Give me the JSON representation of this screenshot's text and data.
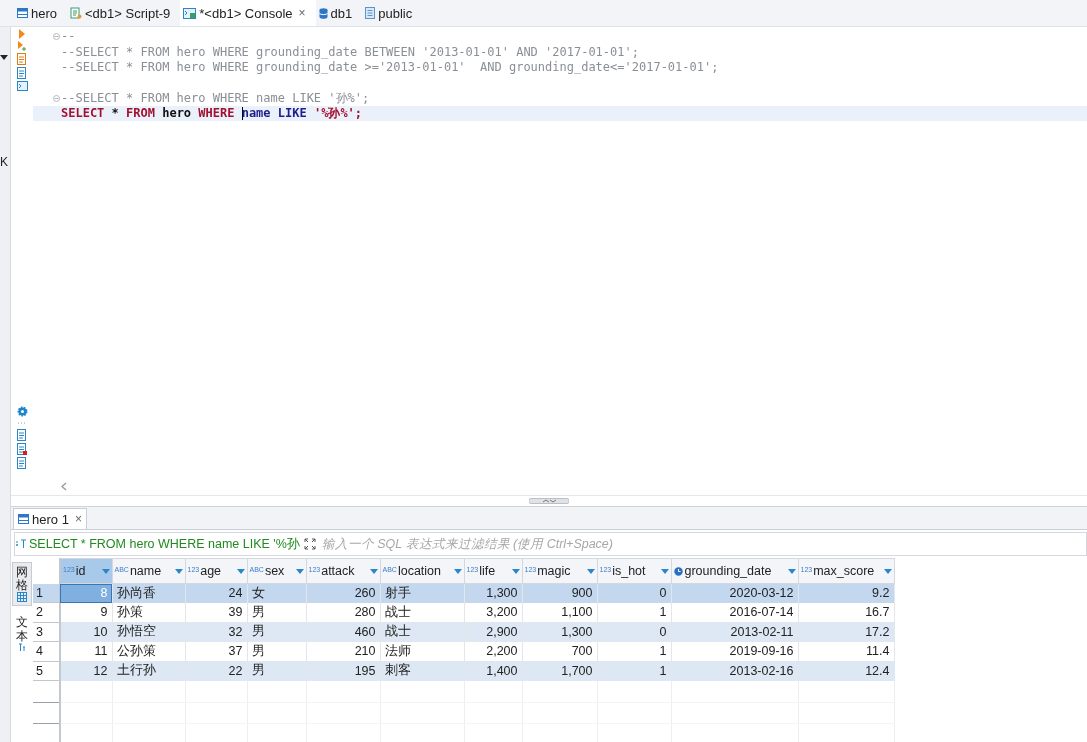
{
  "editor_tabs": [
    {
      "label": "hero",
      "kind": "table",
      "selected": false
    },
    {
      "label": "<db1> Script-9",
      "kind": "script",
      "selected": false
    },
    {
      "label": "*<db1> Console",
      "kind": "console",
      "selected": true,
      "close": "×"
    },
    {
      "label": "db1",
      "kind": "database",
      "selected": false
    },
    {
      "label": "public",
      "kind": "schema",
      "selected": false
    }
  ],
  "left_strip": {
    "label": "K"
  },
  "editor": {
    "lines": [
      {
        "kind": "code",
        "fold": true,
        "current": false,
        "tokens": [
          {
            "kind": "comment",
            "text": "--"
          }
        ]
      },
      {
        "kind": "code",
        "fold": false,
        "current": false,
        "tokens": [
          {
            "kind": "comment",
            "text": "--SELECT * FROM hero WHERE grounding_date BETWEEN '2013-01-01' AND '2017-01-01';"
          }
        ]
      },
      {
        "kind": "code",
        "fold": false,
        "current": false,
        "tokens": [
          {
            "kind": "comment",
            "text": "--SELECT * FROM hero WHERE grounding_date >='2013-01-01'  AND grounding_date<='2017-01-01';"
          }
        ]
      },
      {
        "kind": "blank"
      },
      {
        "kind": "code",
        "fold": true,
        "current": false,
        "tokens": [
          {
            "kind": "comment",
            "text": "--SELECT * FROM hero WHERE name LIKE '孙%';"
          }
        ]
      },
      {
        "kind": "code",
        "fold": false,
        "current": true,
        "tokens": [
          {
            "kind": "keyword",
            "text": "SELECT"
          },
          {
            "kind": "plain",
            "text": " * "
          },
          {
            "kind": "keyword",
            "text": "FROM"
          },
          {
            "kind": "identifier",
            "text": " hero "
          },
          {
            "kind": "keyword",
            "text": "WHERE "
          },
          {
            "kind": "column",
            "text": "name",
            "cursor": true
          },
          {
            "kind": "operator",
            "text": " LIKE "
          },
          {
            "kind": "string",
            "text": "'%孙%'"
          },
          {
            "kind": "keyword",
            "text": ";"
          }
        ]
      }
    ]
  },
  "results": {
    "tab": {
      "label": "hero 1",
      "close": "×"
    },
    "filter": {
      "query": "SELECT * FROM hero WHERE name LIKE '%孙",
      "placeholder": "输入一个 SQL 表达式来过滤结果 (使用 Ctrl+Space)"
    },
    "view_tabs": [
      {
        "label": "网格",
        "kind": "grid",
        "selected": true
      },
      {
        "label": "文本",
        "kind": "text",
        "selected": false
      }
    ],
    "columns": [
      {
        "label": "id",
        "kind": "number",
        "badge": "123",
        "selected": true
      },
      {
        "label": "name",
        "kind": "text",
        "badge": "ABC",
        "selected": false
      },
      {
        "label": "age",
        "kind": "number",
        "badge": "123",
        "selected": false
      },
      {
        "label": "sex",
        "kind": "text",
        "badge": "ABC",
        "selected": false
      },
      {
        "label": "attack",
        "kind": "number",
        "badge": "123",
        "selected": false
      },
      {
        "label": "location",
        "kind": "text",
        "badge": "ABC",
        "selected": false
      },
      {
        "label": "life",
        "kind": "number",
        "badge": "123",
        "selected": false
      },
      {
        "label": "magic",
        "kind": "number",
        "badge": "123",
        "selected": false
      },
      {
        "label": "is_hot",
        "kind": "number",
        "badge": "123",
        "selected": false
      },
      {
        "label": "grounding_date",
        "kind": "date",
        "selected": false
      },
      {
        "label": "max_score",
        "kind": "number",
        "badge": "123",
        "selected": false
      }
    ],
    "rows": [
      {
        "number": "1",
        "selected": true,
        "cells": [
          "8",
          "孙尚香",
          "24",
          "女",
          "260",
          "射手",
          "1,300",
          "900",
          "0",
          "2020-03-12",
          "9.2"
        ]
      },
      {
        "number": "2",
        "selected": false,
        "cells": [
          "9",
          "孙策",
          "39",
          "男",
          "280",
          "战士",
          "3,200",
          "1,100",
          "1",
          "2016-07-14",
          "16.7"
        ]
      },
      {
        "number": "3",
        "selected": false,
        "cells": [
          "10",
          "孙悟空",
          "32",
          "男",
          "460",
          "战士",
          "2,900",
          "1,300",
          "0",
          "2013-02-11",
          "17.2"
        ]
      },
      {
        "number": "4",
        "selected": false,
        "cells": [
          "11",
          "公孙策",
          "37",
          "男",
          "210",
          "法师",
          "2,200",
          "700",
          "1",
          "2019-09-16",
          "11.4"
        ]
      },
      {
        "number": "5",
        "selected": false,
        "cells": [
          "12",
          "土行孙",
          "22",
          "男",
          "195",
          "刺客",
          "1,400",
          "1,700",
          "1",
          "2013-02-16",
          "12.4"
        ]
      }
    ]
  }
}
